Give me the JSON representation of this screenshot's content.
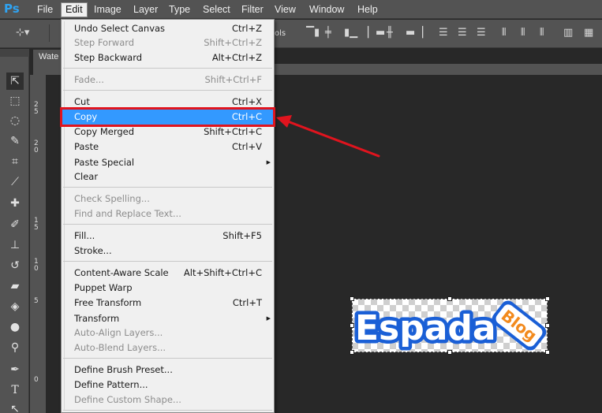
{
  "app": {
    "logo": "Ps"
  },
  "menubar": {
    "items": [
      {
        "label": "File"
      },
      {
        "label": "Edit"
      },
      {
        "label": "Image"
      },
      {
        "label": "Layer"
      },
      {
        "label": "Type"
      },
      {
        "label": "Select"
      },
      {
        "label": "Filter"
      },
      {
        "label": "View"
      },
      {
        "label": "Window"
      },
      {
        "label": "Help"
      }
    ]
  },
  "options": {
    "partial_label": "ols"
  },
  "document": {
    "tab_label": "Wate",
    "ruler_left": [
      "2",
      "5",
      "2",
      "0",
      "1",
      "5",
      "1",
      "0",
      "5",
      "0"
    ],
    "logo_text": "Espada",
    "logo_badge": "Blog"
  },
  "edit_menu": {
    "items": [
      {
        "label": "Undo Select Canvas",
        "shortcut": "Ctrl+Z"
      },
      {
        "label": "Step Forward",
        "shortcut": "Shift+Ctrl+Z"
      },
      {
        "label": "Step Backward",
        "shortcut": "Alt+Ctrl+Z"
      },
      {
        "label": "Fade...",
        "shortcut": "Shift+Ctrl+F"
      },
      {
        "label": "Cut",
        "shortcut": "Ctrl+X"
      },
      {
        "label": "Copy",
        "shortcut": "Ctrl+C"
      },
      {
        "label": "Copy Merged",
        "shortcut": "Shift+Ctrl+C"
      },
      {
        "label": "Paste",
        "shortcut": "Ctrl+V"
      },
      {
        "label": "Paste Special",
        "shortcut": ""
      },
      {
        "label": "Clear",
        "shortcut": ""
      },
      {
        "label": "Check Spelling...",
        "shortcut": ""
      },
      {
        "label": "Find and Replace Text...",
        "shortcut": ""
      },
      {
        "label": "Fill...",
        "shortcut": "Shift+F5"
      },
      {
        "label": "Stroke...",
        "shortcut": ""
      },
      {
        "label": "Content-Aware Scale",
        "shortcut": "Alt+Shift+Ctrl+C"
      },
      {
        "label": "Puppet Warp",
        "shortcut": ""
      },
      {
        "label": "Free Transform",
        "shortcut": "Ctrl+T"
      },
      {
        "label": "Transform",
        "shortcut": ""
      },
      {
        "label": "Auto-Align Layers...",
        "shortcut": ""
      },
      {
        "label": "Auto-Blend Layers...",
        "shortcut": ""
      },
      {
        "label": "Define Brush Preset...",
        "shortcut": ""
      },
      {
        "label": "Define Pattern...",
        "shortcut": ""
      },
      {
        "label": "Define Custom Shape...",
        "shortcut": ""
      }
    ]
  },
  "colors": {
    "highlight": "#3399ff",
    "annotation_red": "#e0141e",
    "logo_blue": "#1a5fd6",
    "badge_orange": "#f28a1d"
  }
}
